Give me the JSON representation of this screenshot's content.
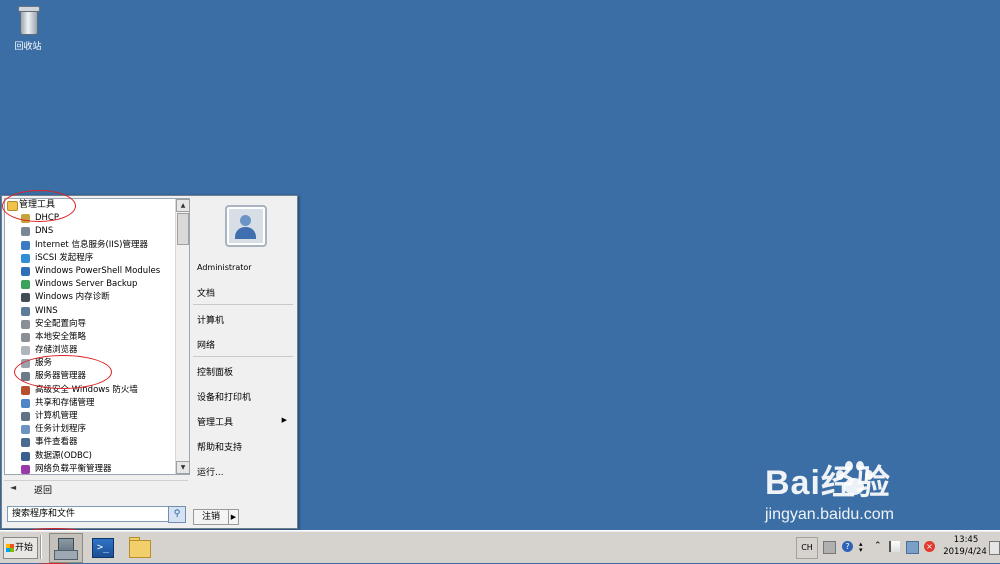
{
  "desktop": {
    "recycle_bin_label": "回收站"
  },
  "start_menu": {
    "programs": [
      {
        "label": "管理工具",
        "icon": "folder-icon",
        "level": 0,
        "color": "#f1c24b"
      },
      {
        "label": "DHCP",
        "icon": "dhcp-icon",
        "level": 1,
        "color": "#c8a23a"
      },
      {
        "label": "DNS",
        "icon": "dns-icon",
        "level": 1,
        "color": "#7b8794"
      },
      {
        "label": "Internet 信息服务(IIS)管理器",
        "icon": "iis-icon",
        "level": 1,
        "color": "#3b7bc4"
      },
      {
        "label": "iSCSI 发起程序",
        "icon": "globe-icon",
        "level": 1,
        "color": "#2f8fd4"
      },
      {
        "label": "Windows PowerShell Modules",
        "icon": "powershell-icon",
        "level": 1,
        "color": "#2f6fb8"
      },
      {
        "label": "Windows Server Backup",
        "icon": "backup-icon",
        "level": 1,
        "color": "#3aa35b"
      },
      {
        "label": "Windows 内存诊断",
        "icon": "memory-icon",
        "level": 1,
        "color": "#444c55"
      },
      {
        "label": "WINS",
        "icon": "wins-icon",
        "level": 1,
        "color": "#5d7c9a"
      },
      {
        "label": "安全配置向导",
        "icon": "security-wizard-icon",
        "level": 1,
        "color": "#8a8f96"
      },
      {
        "label": "本地安全策略",
        "icon": "policy-icon",
        "level": 1,
        "color": "#8a8f96"
      },
      {
        "label": "存储浏览器",
        "icon": "storage-icon",
        "level": 1,
        "color": "#b0b5bb"
      },
      {
        "label": "服务",
        "icon": "gear-icon",
        "level": 1,
        "color": "#9aa3ab"
      },
      {
        "label": "服务器管理器",
        "icon": "server-manager-icon",
        "level": 1,
        "color": "#6c7b88"
      },
      {
        "label": "高级安全 Windows 防火墙",
        "icon": "firewall-icon",
        "level": 1,
        "color": "#b8502f"
      },
      {
        "label": "共享和存储管理",
        "icon": "share-icon",
        "level": 1,
        "color": "#4f86c6"
      },
      {
        "label": "计算机管理",
        "icon": "computer-management-icon",
        "level": 1,
        "color": "#5f7288"
      },
      {
        "label": "任务计划程序",
        "icon": "clock-icon",
        "level": 1,
        "color": "#6d93c2"
      },
      {
        "label": "事件查看器",
        "icon": "event-viewer-icon",
        "level": 1,
        "color": "#4b6a90"
      },
      {
        "label": "数据源(ODBC)",
        "icon": "odbc-icon",
        "level": 1,
        "color": "#3a5f8f"
      },
      {
        "label": "网络负载平衡管理器",
        "icon": "nlb-icon",
        "level": 1,
        "color": "#9a3aa8"
      }
    ],
    "back_label": "返回",
    "search_placeholder": "搜索程序和文件",
    "right": {
      "user": "Administrator",
      "documents": "文档",
      "computer": "计算机",
      "network": "网络",
      "control_panel": "控制面板",
      "devices_printers": "设备和打印机",
      "admin_tools": "管理工具",
      "help_support": "帮助和支持",
      "run": "运行...",
      "logoff": "注销"
    }
  },
  "taskbar": {
    "start_label": "开始",
    "language": "CH",
    "clock_time": "13:45",
    "clock_date": "2019/4/24"
  },
  "watermark": {
    "brand": "Bai经验",
    "url": "jingyan.baidu.com"
  }
}
